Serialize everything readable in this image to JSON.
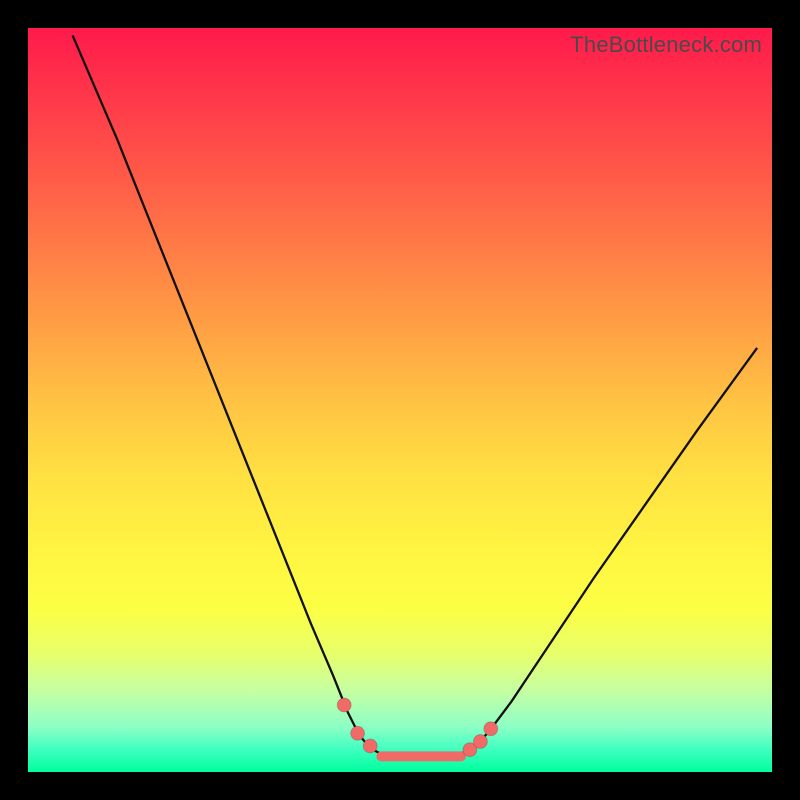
{
  "watermark": "TheBottleneck.com",
  "chart_data": {
    "type": "line",
    "title": "",
    "xlabel": "",
    "ylabel": "",
    "xlim": [
      0,
      100
    ],
    "ylim": [
      0,
      100
    ],
    "grid": false,
    "legend": false,
    "series": [
      {
        "name": "left-curve",
        "x": [
          6,
          12,
          18,
          24,
          30,
          34,
          38,
          41,
          43,
          44.5,
          46,
          47.5
        ],
        "y": [
          99,
          85,
          70,
          55,
          40,
          30,
          20,
          13,
          8,
          5,
          3.2,
          2.4
        ]
      },
      {
        "name": "valley",
        "x": [
          47.5,
          49,
          51,
          53,
          55,
          57,
          58.5
        ],
        "y": [
          2.4,
          2.0,
          1.9,
          1.9,
          2.0,
          2.2,
          2.6
        ]
      },
      {
        "name": "right-curve",
        "x": [
          58.5,
          60,
          62,
          65,
          70,
          76,
          83,
          90,
          98
        ],
        "y": [
          2.6,
          3.3,
          5.5,
          9.5,
          17,
          26,
          36,
          46,
          57
        ]
      }
    ],
    "points": [
      {
        "name": "left-shoulder-1",
        "x": 42.5,
        "y": 9.0
      },
      {
        "name": "left-shoulder-2",
        "x": 44.3,
        "y": 5.2
      },
      {
        "name": "left-shoulder-3",
        "x": 46.0,
        "y": 3.5
      },
      {
        "name": "right-shoulder-1",
        "x": 59.4,
        "y": 3.0
      },
      {
        "name": "right-shoulder-2",
        "x": 60.8,
        "y": 4.1
      },
      {
        "name": "right-shoulder-3",
        "x": 62.2,
        "y": 5.8
      }
    ],
    "valley_band": {
      "x0": 47.5,
      "x1": 58.2,
      "y": 2.1
    }
  }
}
